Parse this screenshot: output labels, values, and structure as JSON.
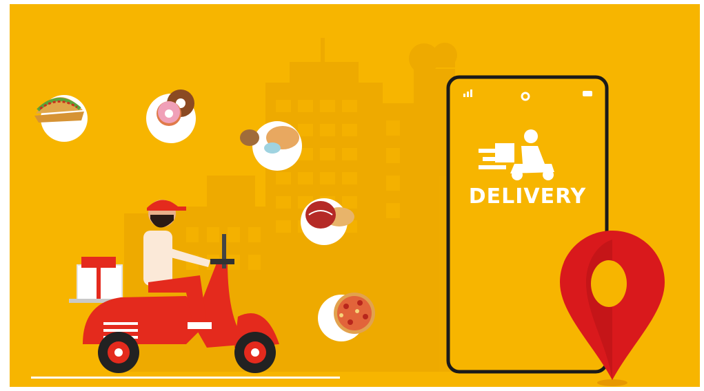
{
  "phone": {
    "screen_label": "DELIVERY"
  },
  "colors": {
    "background": "#F7B500",
    "frame": "#ffffff",
    "building": "#E9A600",
    "scooter_red": "#E42A1D",
    "phone_border": "#1a1a1a",
    "pin_red": "#D9191C",
    "food_plate": "#ffffff"
  },
  "illustration": {
    "icons": [
      "taco-icon",
      "donut-icon",
      "croissant-icon",
      "macaron-icon",
      "pizza-icon",
      "delivery-scooter-icon",
      "location-pin-icon",
      "signal-icon",
      "battery-icon",
      "camera-icon"
    ]
  }
}
